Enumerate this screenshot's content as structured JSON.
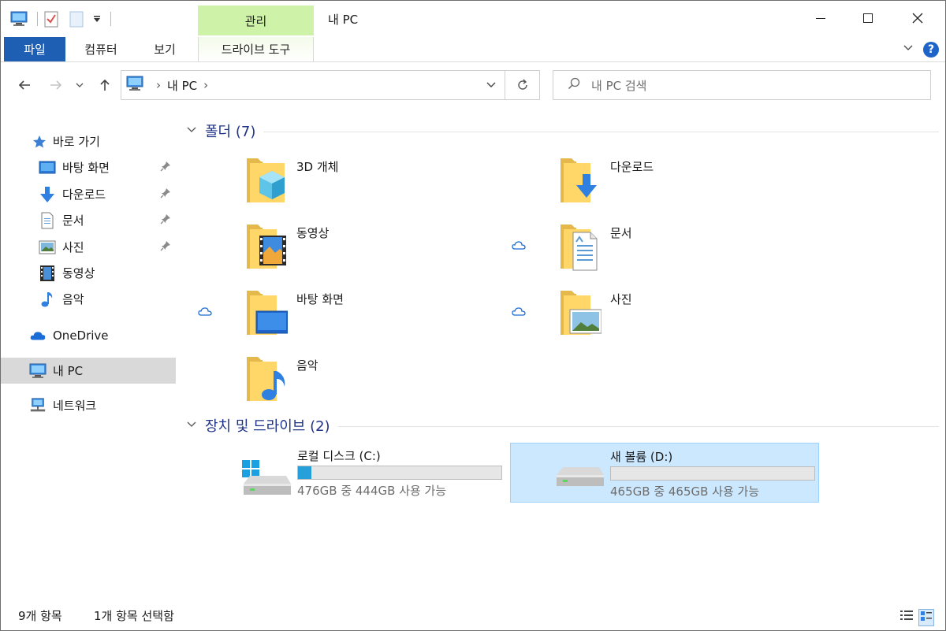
{
  "window": {
    "title": "내 PC",
    "context_tab_group": "관리"
  },
  "ribbon": {
    "tabs": [
      {
        "label": "파일"
      },
      {
        "label": "컴퓨터"
      },
      {
        "label": "보기"
      },
      {
        "label": "드라이브 도구"
      }
    ]
  },
  "address": {
    "crumb": "내 PC",
    "search_placeholder": "내 PC 검색"
  },
  "sidebar": {
    "items": [
      {
        "label": "바로 가기",
        "icon": "star-icon"
      },
      {
        "label": "바탕 화면",
        "icon": "desktop-icon",
        "pinned": true
      },
      {
        "label": "다운로드",
        "icon": "download-icon",
        "pinned": true
      },
      {
        "label": "문서",
        "icon": "document-icon",
        "pinned": true
      },
      {
        "label": "사진",
        "icon": "pictures-icon",
        "pinned": true
      },
      {
        "label": "동영상",
        "icon": "video-icon"
      },
      {
        "label": "음악",
        "icon": "music-icon"
      },
      {
        "label": "OneDrive",
        "icon": "onedrive-icon"
      },
      {
        "label": "내 PC",
        "icon": "pc-icon",
        "selected": true
      },
      {
        "label": "네트워크",
        "icon": "network-icon"
      }
    ]
  },
  "groups": {
    "folders_title": "폴더 (7)",
    "drives_title": "장치 및 드라이브 (2)"
  },
  "folders": [
    {
      "name": "3D 개체",
      "overlay": "cube-icon",
      "cloud": false
    },
    {
      "name": "다운로드",
      "overlay": "download-icon",
      "cloud": false
    },
    {
      "name": "동영상",
      "overlay": "video-icon",
      "cloud": false
    },
    {
      "name": "문서",
      "overlay": "document-icon",
      "cloud": true
    },
    {
      "name": "바탕 화면",
      "overlay": "desktop-icon",
      "cloud": true
    },
    {
      "name": "사진",
      "overlay": "pictures-icon",
      "cloud": true
    },
    {
      "name": "음악",
      "overlay": "music-icon",
      "cloud": false
    }
  ],
  "drives": [
    {
      "name": "로컬 디스크 (C:)",
      "free": "476GB 중 444GB 사용 가능",
      "used_fraction": 0.067,
      "system": true,
      "selected": false
    },
    {
      "name": "새 볼륨 (D:)",
      "free": "465GB 중 465GB 사용 가능",
      "used_fraction": 0.0,
      "system": false,
      "selected": true
    }
  ],
  "status": {
    "count": "9개 항목",
    "selection": "1개 항목 선택함"
  },
  "colors": {
    "accent": "#1e5fb3",
    "context_tab": "#cdf2a8",
    "group_title": "#1e3287",
    "drive_fill": "#26a0da",
    "selection": "#cce8ff"
  }
}
